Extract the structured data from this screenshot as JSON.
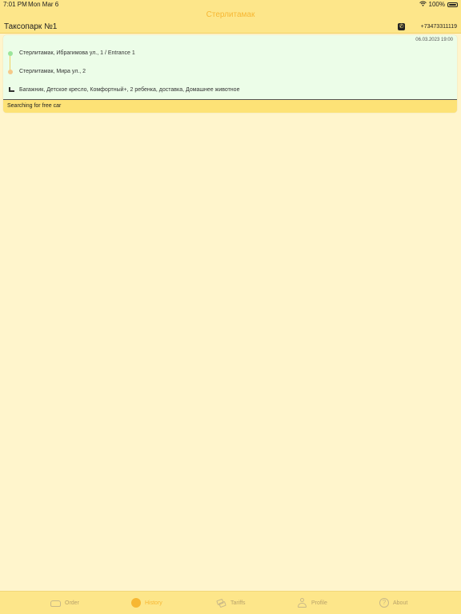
{
  "status_bar": {
    "time": "7:01 PM",
    "date": "Mon Mar 6",
    "battery": "100%"
  },
  "nav": {
    "title": "Стерлитамак"
  },
  "company": {
    "name": "Таксопарк №1",
    "phone": "+73473311119",
    "phone_icon": "phone-icon"
  },
  "order": {
    "datetime": "06.03.2023 19:00",
    "from": "Стерлитамак, Ибрагимова ул., 1 / Entrance 1",
    "to": "Стерлитамак, Мира ул., 2",
    "options": "Багажник, Детское кресло, Комфортный+, 2 ребенка, доставка, Домашнее животное",
    "status": "Searching for free car"
  },
  "tabs": [
    {
      "label": "Order",
      "icon": "car-icon"
    },
    {
      "label": "History",
      "icon": "history-icon"
    },
    {
      "label": "Tariffs",
      "icon": "tariffs-icon"
    },
    {
      "label": "Profile",
      "icon": "profile-icon"
    },
    {
      "label": "About",
      "icon": "about-icon"
    }
  ],
  "colors": {
    "background": "#fff5cc",
    "bar": "#fde68a",
    "accent": "#f7b733",
    "card": "#ecfde8",
    "status": "#fde276"
  }
}
